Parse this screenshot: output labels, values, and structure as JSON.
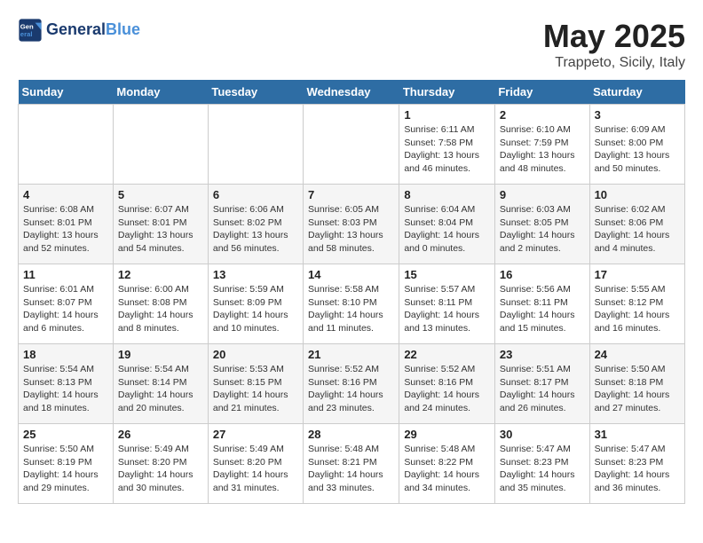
{
  "header": {
    "logo_line1": "General",
    "logo_line2": "Blue",
    "month": "May 2025",
    "location": "Trappeto, Sicily, Italy"
  },
  "weekdays": [
    "Sunday",
    "Monday",
    "Tuesday",
    "Wednesday",
    "Thursday",
    "Friday",
    "Saturday"
  ],
  "weeks": [
    [
      {
        "day": "",
        "info": ""
      },
      {
        "day": "",
        "info": ""
      },
      {
        "day": "",
        "info": ""
      },
      {
        "day": "",
        "info": ""
      },
      {
        "day": "1",
        "info": "Sunrise: 6:11 AM\nSunset: 7:58 PM\nDaylight: 13 hours\nand 46 minutes."
      },
      {
        "day": "2",
        "info": "Sunrise: 6:10 AM\nSunset: 7:59 PM\nDaylight: 13 hours\nand 48 minutes."
      },
      {
        "day": "3",
        "info": "Sunrise: 6:09 AM\nSunset: 8:00 PM\nDaylight: 13 hours\nand 50 minutes."
      }
    ],
    [
      {
        "day": "4",
        "info": "Sunrise: 6:08 AM\nSunset: 8:01 PM\nDaylight: 13 hours\nand 52 minutes."
      },
      {
        "day": "5",
        "info": "Sunrise: 6:07 AM\nSunset: 8:01 PM\nDaylight: 13 hours\nand 54 minutes."
      },
      {
        "day": "6",
        "info": "Sunrise: 6:06 AM\nSunset: 8:02 PM\nDaylight: 13 hours\nand 56 minutes."
      },
      {
        "day": "7",
        "info": "Sunrise: 6:05 AM\nSunset: 8:03 PM\nDaylight: 13 hours\nand 58 minutes."
      },
      {
        "day": "8",
        "info": "Sunrise: 6:04 AM\nSunset: 8:04 PM\nDaylight: 14 hours\nand 0 minutes."
      },
      {
        "day": "9",
        "info": "Sunrise: 6:03 AM\nSunset: 8:05 PM\nDaylight: 14 hours\nand 2 minutes."
      },
      {
        "day": "10",
        "info": "Sunrise: 6:02 AM\nSunset: 8:06 PM\nDaylight: 14 hours\nand 4 minutes."
      }
    ],
    [
      {
        "day": "11",
        "info": "Sunrise: 6:01 AM\nSunset: 8:07 PM\nDaylight: 14 hours\nand 6 minutes."
      },
      {
        "day": "12",
        "info": "Sunrise: 6:00 AM\nSunset: 8:08 PM\nDaylight: 14 hours\nand 8 minutes."
      },
      {
        "day": "13",
        "info": "Sunrise: 5:59 AM\nSunset: 8:09 PM\nDaylight: 14 hours\nand 10 minutes."
      },
      {
        "day": "14",
        "info": "Sunrise: 5:58 AM\nSunset: 8:10 PM\nDaylight: 14 hours\nand 11 minutes."
      },
      {
        "day": "15",
        "info": "Sunrise: 5:57 AM\nSunset: 8:11 PM\nDaylight: 14 hours\nand 13 minutes."
      },
      {
        "day": "16",
        "info": "Sunrise: 5:56 AM\nSunset: 8:11 PM\nDaylight: 14 hours\nand 15 minutes."
      },
      {
        "day": "17",
        "info": "Sunrise: 5:55 AM\nSunset: 8:12 PM\nDaylight: 14 hours\nand 16 minutes."
      }
    ],
    [
      {
        "day": "18",
        "info": "Sunrise: 5:54 AM\nSunset: 8:13 PM\nDaylight: 14 hours\nand 18 minutes."
      },
      {
        "day": "19",
        "info": "Sunrise: 5:54 AM\nSunset: 8:14 PM\nDaylight: 14 hours\nand 20 minutes."
      },
      {
        "day": "20",
        "info": "Sunrise: 5:53 AM\nSunset: 8:15 PM\nDaylight: 14 hours\nand 21 minutes."
      },
      {
        "day": "21",
        "info": "Sunrise: 5:52 AM\nSunset: 8:16 PM\nDaylight: 14 hours\nand 23 minutes."
      },
      {
        "day": "22",
        "info": "Sunrise: 5:52 AM\nSunset: 8:16 PM\nDaylight: 14 hours\nand 24 minutes."
      },
      {
        "day": "23",
        "info": "Sunrise: 5:51 AM\nSunset: 8:17 PM\nDaylight: 14 hours\nand 26 minutes."
      },
      {
        "day": "24",
        "info": "Sunrise: 5:50 AM\nSunset: 8:18 PM\nDaylight: 14 hours\nand 27 minutes."
      }
    ],
    [
      {
        "day": "25",
        "info": "Sunrise: 5:50 AM\nSunset: 8:19 PM\nDaylight: 14 hours\nand 29 minutes."
      },
      {
        "day": "26",
        "info": "Sunrise: 5:49 AM\nSunset: 8:20 PM\nDaylight: 14 hours\nand 30 minutes."
      },
      {
        "day": "27",
        "info": "Sunrise: 5:49 AM\nSunset: 8:20 PM\nDaylight: 14 hours\nand 31 minutes."
      },
      {
        "day": "28",
        "info": "Sunrise: 5:48 AM\nSunset: 8:21 PM\nDaylight: 14 hours\nand 33 minutes."
      },
      {
        "day": "29",
        "info": "Sunrise: 5:48 AM\nSunset: 8:22 PM\nDaylight: 14 hours\nand 34 minutes."
      },
      {
        "day": "30",
        "info": "Sunrise: 5:47 AM\nSunset: 8:23 PM\nDaylight: 14 hours\nand 35 minutes."
      },
      {
        "day": "31",
        "info": "Sunrise: 5:47 AM\nSunset: 8:23 PM\nDaylight: 14 hours\nand 36 minutes."
      }
    ]
  ]
}
